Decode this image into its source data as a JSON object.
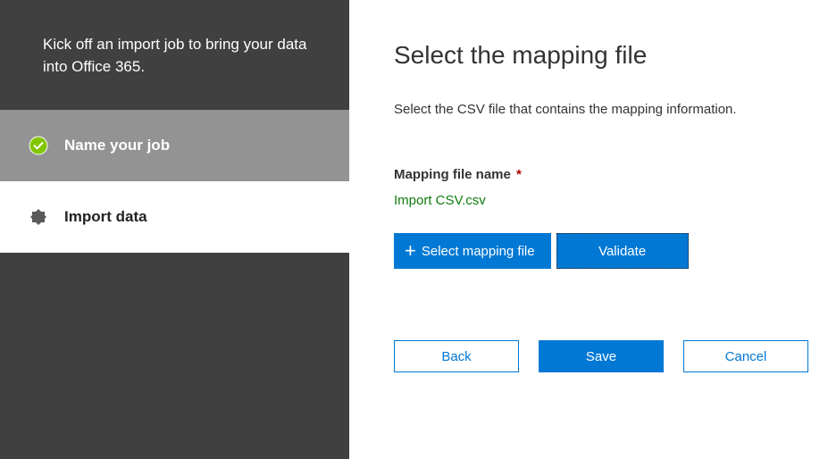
{
  "sidebar": {
    "intro": "Kick off an import job to bring your data into Office 365.",
    "steps": [
      {
        "label": "Name your job"
      },
      {
        "label": "Import data"
      }
    ]
  },
  "main": {
    "heading": "Select the mapping file",
    "subtext": "Select the CSV file that contains the mapping information.",
    "field_label": "Mapping file name",
    "required_marker": "*",
    "file_name": "Import CSV.csv",
    "select_button": "Select mapping file",
    "validate_button": "Validate",
    "back_button": "Back",
    "save_button": "Save",
    "cancel_button": "Cancel"
  }
}
